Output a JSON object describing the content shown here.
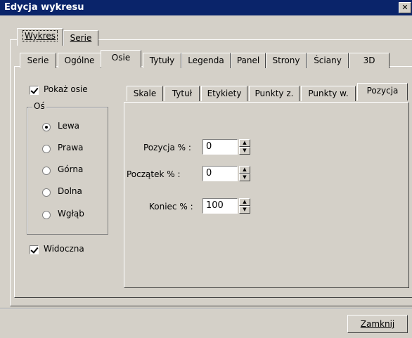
{
  "window": {
    "title": "Edycja wykresu",
    "close_glyph": "✕"
  },
  "top_tabs": [
    {
      "label": "Wykres"
    },
    {
      "label": "Serie"
    }
  ],
  "chart_tabs": [
    {
      "label": "Serie"
    },
    {
      "label": "Ogólne"
    },
    {
      "label": "Osie"
    },
    {
      "label": "Tytuły"
    },
    {
      "label": "Legenda"
    },
    {
      "label": "Panel"
    },
    {
      "label": "Strony"
    },
    {
      "label": "Ściany"
    },
    {
      "label": "3D"
    }
  ],
  "axes": {
    "show_axes_label": "Pokaż osie",
    "show_axes_checked": true,
    "axis_group_label": "Oś",
    "axis_options": [
      {
        "label": "Lewa",
        "selected": true
      },
      {
        "label": "Prawa",
        "selected": false
      },
      {
        "label": "Górna",
        "selected": false
      },
      {
        "label": "Dolna",
        "selected": false
      },
      {
        "label": "Wgłąb",
        "selected": false
      }
    ],
    "visible_label": "Widoczna",
    "visible_checked": true
  },
  "axis_tabs": [
    {
      "label": "Skale"
    },
    {
      "label": "Tytuł"
    },
    {
      "label": "Etykiety"
    },
    {
      "label": "Punkty z."
    },
    {
      "label": "Punkty w."
    },
    {
      "label": "Pozycja"
    }
  ],
  "position": {
    "position_label": "Pozycja % :",
    "position_value": "0",
    "start_label": "Początek % :",
    "start_value": "0",
    "end_label": "Koniec % :",
    "end_value": "100"
  },
  "footer": {
    "close_label": "Zamknij"
  }
}
